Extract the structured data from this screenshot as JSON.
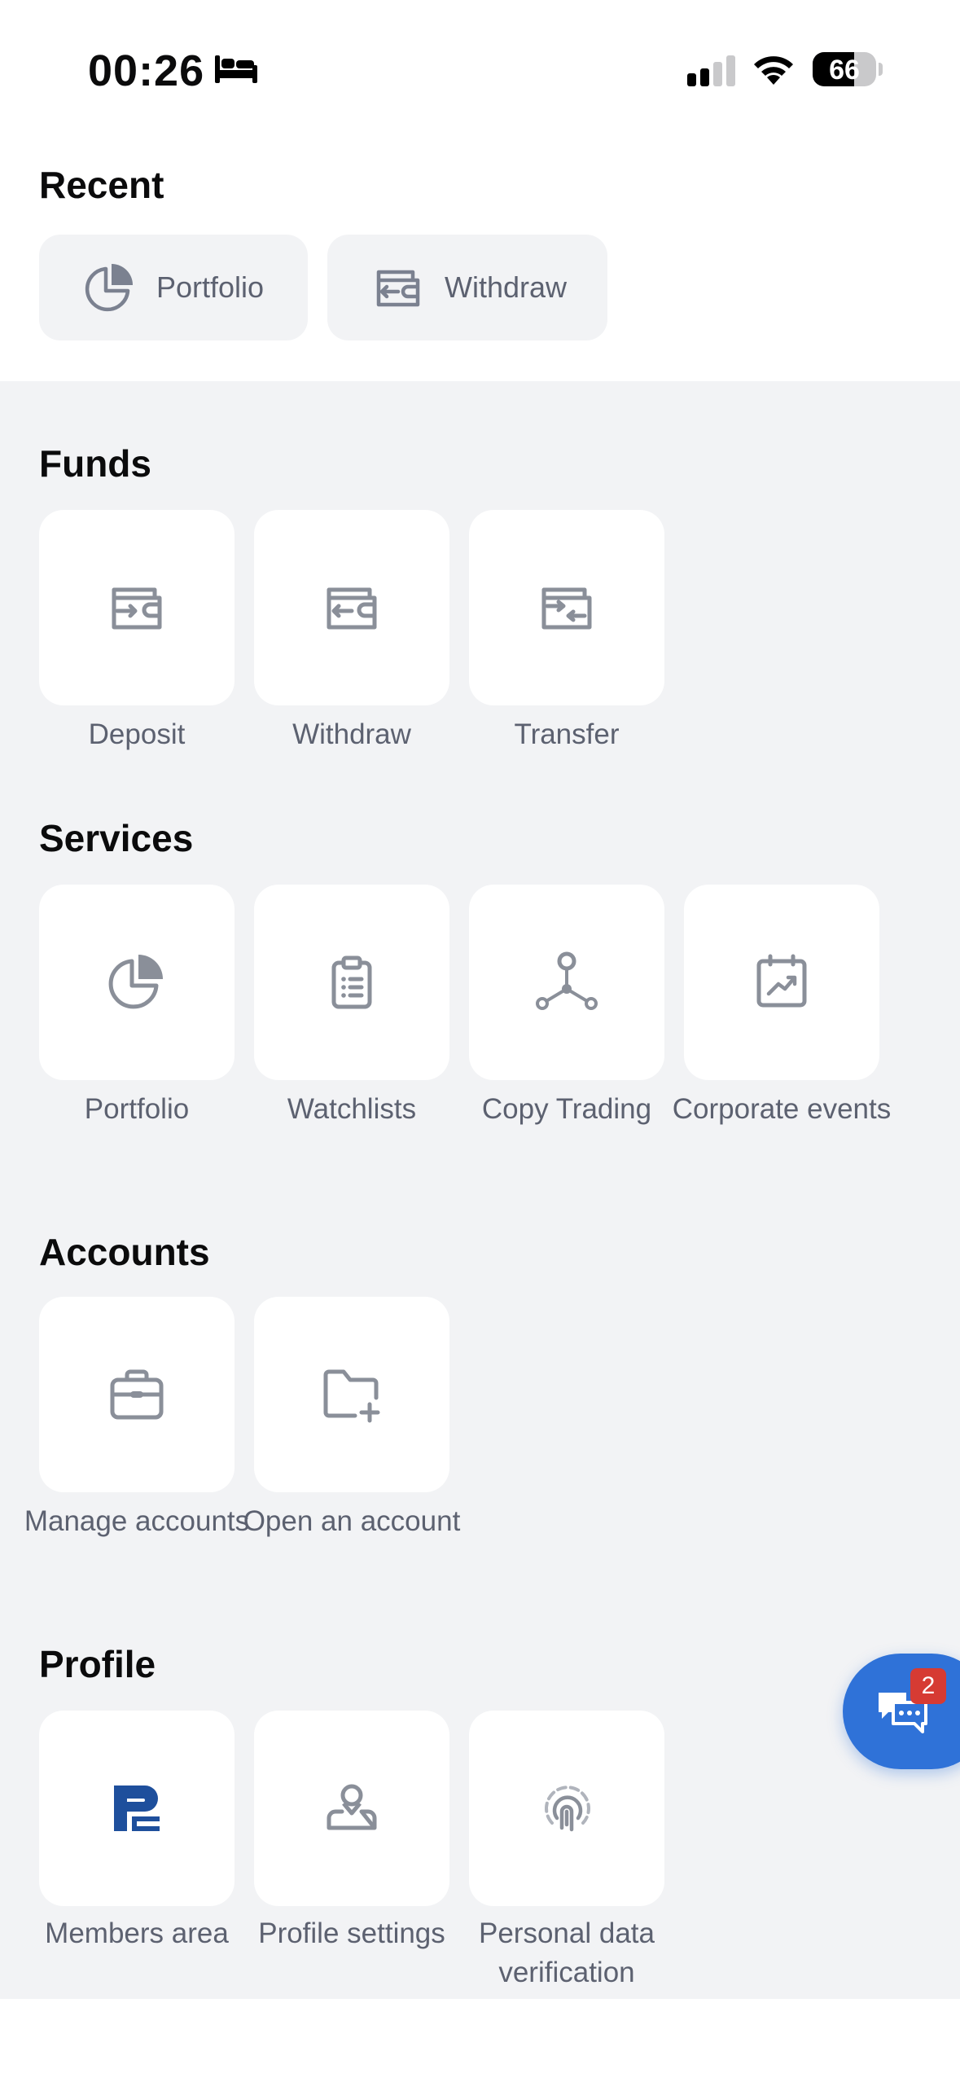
{
  "status_bar": {
    "time": "00:26",
    "battery": "66",
    "battery_level": 0.66
  },
  "recent": {
    "title": "Recent",
    "items": [
      {
        "label": "Portfolio",
        "icon": "pie-chart-icon"
      },
      {
        "label": "Withdraw",
        "icon": "wallet-withdraw-icon"
      }
    ]
  },
  "funds": {
    "title": "Funds",
    "items": [
      {
        "label": "Deposit",
        "icon": "wallet-deposit-icon"
      },
      {
        "label": "Withdraw",
        "icon": "wallet-withdraw-icon"
      },
      {
        "label": "Transfer",
        "icon": "wallet-transfer-icon"
      }
    ]
  },
  "services": {
    "title": "Services",
    "items": [
      {
        "label": "Portfolio",
        "icon": "pie-chart-icon"
      },
      {
        "label": "Watchlists",
        "icon": "clipboard-list-icon"
      },
      {
        "label": "Copy Trading",
        "icon": "network-nodes-icon"
      },
      {
        "label": "Corporate events",
        "icon": "calendar-trend-icon"
      }
    ]
  },
  "accounts": {
    "title": "Accounts",
    "items": [
      {
        "label": "Manage accounts",
        "icon": "briefcase-icon"
      },
      {
        "label": "Open an account",
        "icon": "folder-plus-icon"
      }
    ]
  },
  "profile": {
    "title": "Profile",
    "items": [
      {
        "label": "Members area",
        "icon": "brand-logo-icon"
      },
      {
        "label": "Profile settings",
        "icon": "user-settings-icon"
      },
      {
        "label": "Personal data verification",
        "icon": "fingerprint-icon"
      }
    ]
  },
  "chat": {
    "badge_count": "2"
  },
  "colors": {
    "accent": "#2f72d8",
    "badge": "#d63b33",
    "section_bg": "#f2f3f5",
    "icon_gray": "#8a8f99",
    "brand": "#1e4f9c"
  }
}
